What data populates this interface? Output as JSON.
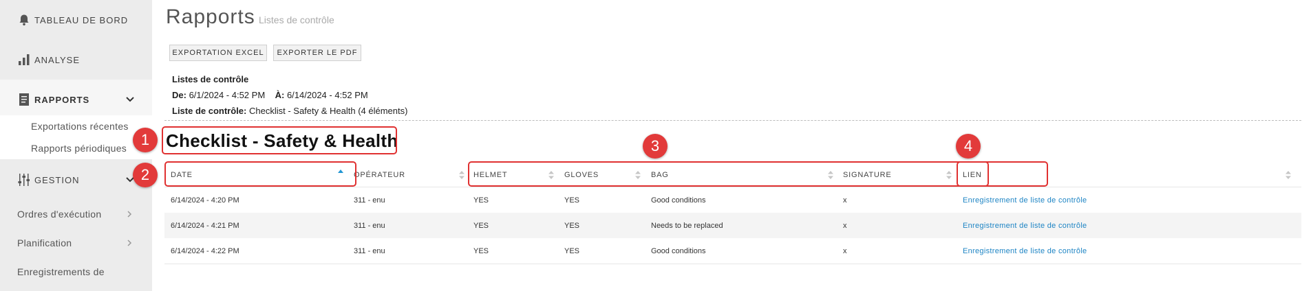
{
  "sidebar": {
    "main_items": [
      {
        "label": "TABLEAU DE BORD",
        "icon": "bell-icon"
      },
      {
        "label": "ANALYSE",
        "icon": "bar-chart-icon"
      },
      {
        "label": "RAPPORTS",
        "icon": "report-icon"
      },
      {
        "label": "GESTION",
        "icon": "sliders-icon"
      }
    ],
    "sub_items": [
      "Exportations récentes",
      "Rapports périodiques"
    ],
    "gestion_items": [
      "Ordres d'exécution",
      "Planification",
      "Enregistrements de"
    ]
  },
  "header": {
    "title": "Rapports",
    "subtitle": "Listes de contrôle"
  },
  "toolbar": {
    "excel_label": "EXPORTATION EXCEL",
    "pdf_label": "EXPORTER LE PDF"
  },
  "report_meta": {
    "heading": "Listes de contrôle",
    "from_label": "De:",
    "from_value": "6/1/2024 - 4:52 PM",
    "to_label": "À:",
    "to_value": "6/14/2024 - 4:52 PM",
    "checklist_label": "Liste de contrôle:",
    "checklist_value": "Checklist - Safety & Health (4 éléments)"
  },
  "checklist_title": "Checklist - Safety & Health",
  "table": {
    "columns": [
      "DATE",
      "OPÉRATEUR",
      "HELMET",
      "GLOVES",
      "BAG",
      "SIGNATURE",
      "LIEN"
    ],
    "rows": [
      [
        "6/14/2024 - 4:20 PM",
        "311 - enu",
        "YES",
        "YES",
        "Good conditions",
        "x",
        "Enregistrement de liste de contrôle"
      ],
      [
        "6/14/2024 - 4:21 PM",
        "311 - enu",
        "YES",
        "YES",
        "Needs to be replaced",
        "x",
        "Enregistrement de liste de contrôle"
      ],
      [
        "6/14/2024 - 4:22 PM",
        "311 - enu",
        "YES",
        "YES",
        "Good conditions",
        "x",
        "Enregistrement de liste de contrôle"
      ]
    ]
  },
  "annotations": [
    "1",
    "2",
    "3",
    "4"
  ],
  "colors": {
    "annotation_red": "#e03030",
    "link_blue": "#1d84c4",
    "sort_active": "#2196d3"
  }
}
